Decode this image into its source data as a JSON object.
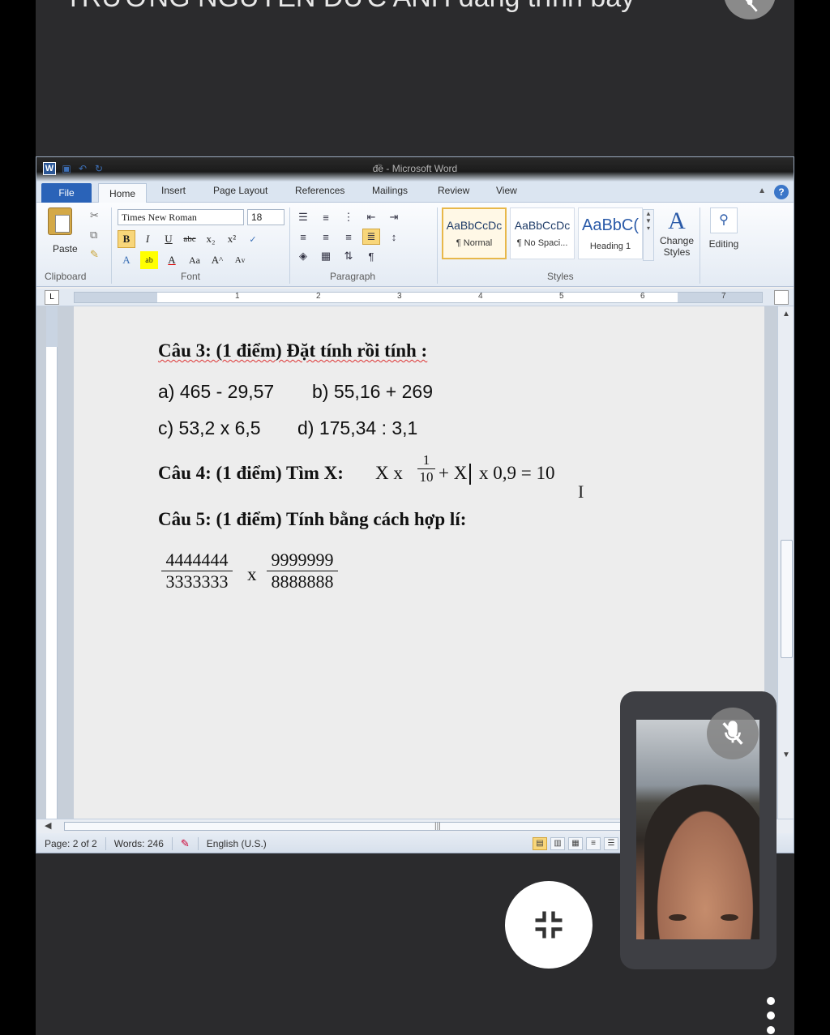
{
  "call": {
    "title_partial": "TRƯỜNG NGUYỄN ĐỨC ANH đang trình bày",
    "exit_icon": "minimize-icon",
    "mic_icon": "mic-off-icon"
  },
  "word": {
    "title": "đề - Microsoft Word",
    "tabs": [
      "File",
      "Home",
      "Insert",
      "Page Layout",
      "References",
      "Mailings",
      "Review",
      "View"
    ],
    "ribbon": {
      "paste_label": "Paste",
      "groups": [
        "Clipboard",
        "Font",
        "Paragraph",
        "Styles"
      ],
      "font_name": "Times New Roman",
      "font_size": "18",
      "styles": [
        {
          "sample": "AaBbCcDc",
          "name": "¶ Normal"
        },
        {
          "sample": "AaBbCcDc",
          "name": "¶ No Spaci..."
        },
        {
          "sample": "AaBbC(",
          "name": "Heading 1"
        }
      ],
      "change_styles": "Change Styles",
      "editing": "Editing"
    },
    "ruler_numbers": [
      "1",
      "2",
      "3",
      "4",
      "5",
      "6",
      "7"
    ],
    "document": {
      "q3": "Câu 3: (1 điểm) Đặt tính rồi tính :",
      "q3_a": "a) 465 - 29,57",
      "q3_b": "b) 55,16 + 269",
      "q3_c": "c) 53,2 x 6,5",
      "q3_d": "d) 175,34 : 3,1",
      "q4_label": "Câu 4: (1 điểm) Tìm X:",
      "q4_expr_left": "X  x",
      "q4_frac_num": "1",
      "q4_frac_den": "10",
      "q4_expr_mid": "+ X",
      "q4_expr_right": "x 0,9 = 10",
      "q5": "Câu 5: (1 điểm) Tính bằng cách hợp lí:",
      "q5_frac1_num": "4444444",
      "q5_frac1_den": "3333333",
      "q5_op": "x",
      "q5_frac2_num": "9999999",
      "q5_frac2_den": "8888888"
    },
    "status": {
      "page": "Page: 2 of 2",
      "words": "Words: 246",
      "language": "English (U.S.)"
    }
  }
}
